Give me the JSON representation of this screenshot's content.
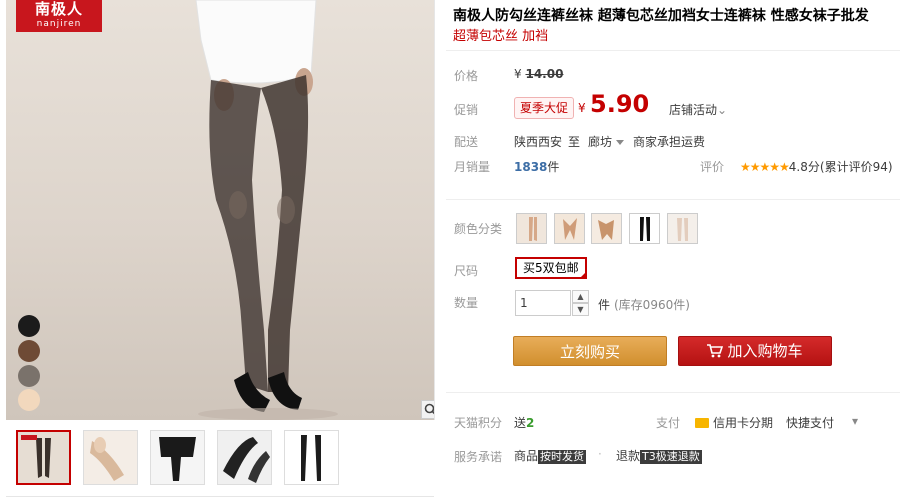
{
  "brand": {
    "logo_cn": "南极人",
    "logo_en": "nanjiren"
  },
  "product": {
    "title": "南极人防勾丝连裤丝袜 超薄包芯丝加裆女士连裤袜 性感女袜子批发",
    "subtitle": "超薄包芯丝 加裆"
  },
  "price": {
    "label": "价格",
    "currency": "¥",
    "original": "14.00",
    "promo_label": "促销",
    "promo_tag": "夏季大促",
    "promo_currency": "¥",
    "promo_value": "5.90",
    "store_promo": "店铺活动",
    "store_promo_chevron": "⌄"
  },
  "delivery": {
    "label": "配送",
    "from": "陕西西安",
    "to_word": "至",
    "destination": "廊坊",
    "fee_note": "商家承担运费"
  },
  "sales": {
    "label": "月销量",
    "count": "1838",
    "unit": "件",
    "rating_label": "评价",
    "stars": "★★★★★",
    "rating_text": "4.8分(累计评价94)"
  },
  "options": {
    "color_label": "颜色分类",
    "size_label": "尺码",
    "size_value": "买5双包邮",
    "qty_label": "数量",
    "qty_value": "1",
    "qty_unit": "件",
    "stock": "(库存0960件)"
  },
  "buttons": {
    "buy_now": "立刻购买",
    "add_to_cart": "加入购物车"
  },
  "points": {
    "label": "天猫积分",
    "give_word": "送",
    "amount": "2",
    "pay_label": "支付",
    "credit_card": "信用卡分期",
    "quick_pay": "快捷支付",
    "chevron": "▾"
  },
  "service": {
    "label": "服务承诺",
    "item1_prefix": "商品",
    "item1_badge": "按时发货",
    "item2_prefix": "退款",
    "item2_badge": "T3极速退款",
    "dot": "·"
  },
  "colors": {
    "accent": "#c40000",
    "buy_button": "#e4a64b",
    "cart_button": "#c91c1c",
    "star": "#ff9a00",
    "sales_count": "#3d6ea6"
  },
  "icons": {
    "zoom": "magnifier-icon",
    "cart": "cart-icon",
    "card": "credit-card-icon"
  }
}
